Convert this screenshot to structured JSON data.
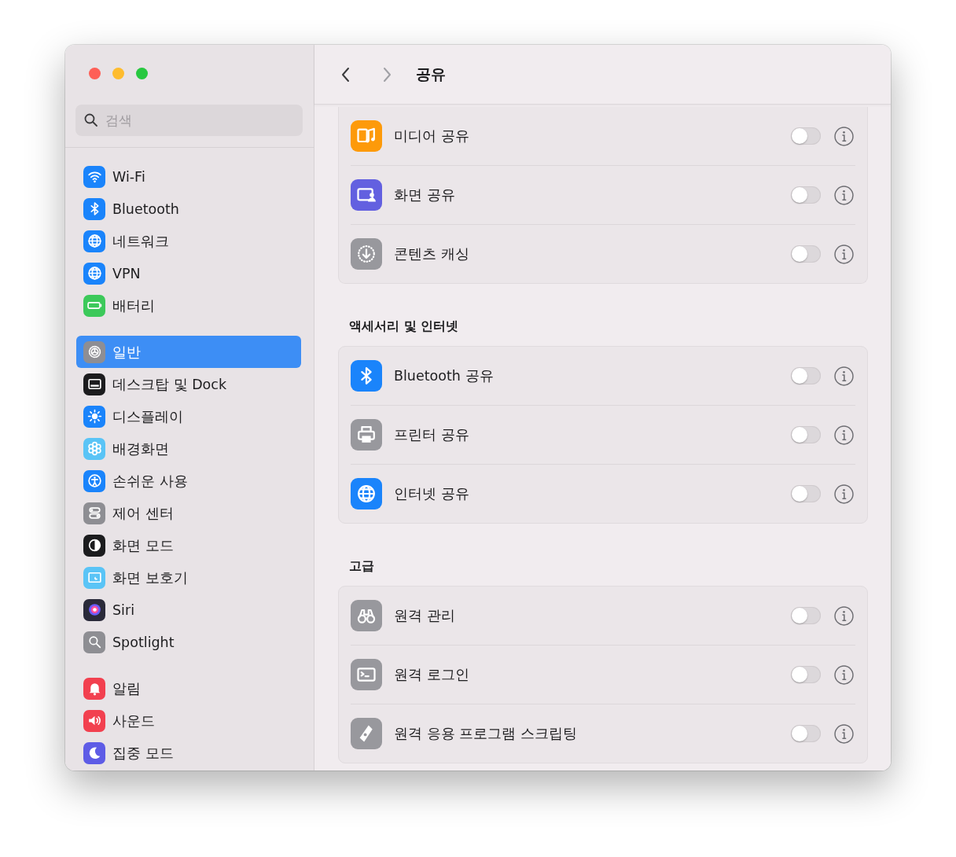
{
  "window": {
    "title": "공유"
  },
  "search": {
    "placeholder": "검색"
  },
  "sidebar": {
    "groups": [
      {
        "items": [
          {
            "label": "Wi-Fi",
            "selected": false,
            "color": "#1a84fb"
          },
          {
            "label": "Bluetooth",
            "selected": false,
            "color": "#1a84fb"
          },
          {
            "label": "네트워크",
            "selected": false,
            "color": "#1a84fb"
          },
          {
            "label": "VPN",
            "selected": false,
            "color": "#1a84fb"
          },
          {
            "label": "배터리",
            "selected": false,
            "color": "#3cc95a"
          }
        ]
      },
      {
        "items": [
          {
            "label": "일반",
            "selected": true,
            "color": "#8e8e93"
          },
          {
            "label": "데스크탑 및 Dock",
            "selected": false,
            "color": "#1c1c1e"
          },
          {
            "label": "디스플레이",
            "selected": false,
            "color": "#1a84fb"
          },
          {
            "label": "배경화면",
            "selected": false,
            "color": "#5ac4f6"
          },
          {
            "label": "손쉬운 사용",
            "selected": false,
            "color": "#1a84fb"
          },
          {
            "label": "제어 센터",
            "selected": false,
            "color": "#8e8e93"
          },
          {
            "label": "화면 모드",
            "selected": false,
            "color": "#1c1c1e"
          },
          {
            "label": "화면 보호기",
            "selected": false,
            "color": "#5ac4f6"
          },
          {
            "label": "Siri",
            "selected": false,
            "color": "#2a2a3a"
          },
          {
            "label": "Spotlight",
            "selected": false,
            "color": "#8e8e93"
          }
        ]
      },
      {
        "items": [
          {
            "label": "알림",
            "selected": false,
            "color": "#f2404f"
          },
          {
            "label": "사운드",
            "selected": false,
            "color": "#f2404f"
          },
          {
            "label": "집중 모드",
            "selected": false,
            "color": "#5e5ce6"
          }
        ]
      }
    ]
  },
  "sections": [
    {
      "rows": [
        {
          "label": "미디어 공유",
          "on": false,
          "color": "#fd9a0a"
        },
        {
          "label": "화면 공유",
          "on": false,
          "color": "#6360e0"
        },
        {
          "label": "콘텐츠 캐싱",
          "on": false,
          "color": "#98989d"
        }
      ]
    },
    {
      "heading": "액세서리 및 인터넷",
      "rows": [
        {
          "label": "Bluetooth 공유",
          "on": false,
          "color": "#1a84fb"
        },
        {
          "label": "프린터 공유",
          "on": false,
          "color": "#98989d"
        },
        {
          "label": "인터넷 공유",
          "on": false,
          "color": "#1a84fb"
        }
      ]
    },
    {
      "heading": "고급",
      "rows": [
        {
          "label": "원격 관리",
          "on": false,
          "color": "#98989d"
        },
        {
          "label": "원격 로그인",
          "on": false,
          "color": "#98989d"
        },
        {
          "label": "원격 응용 프로그램 스크립팅",
          "on": false,
          "color": "#98989d"
        }
      ]
    }
  ]
}
